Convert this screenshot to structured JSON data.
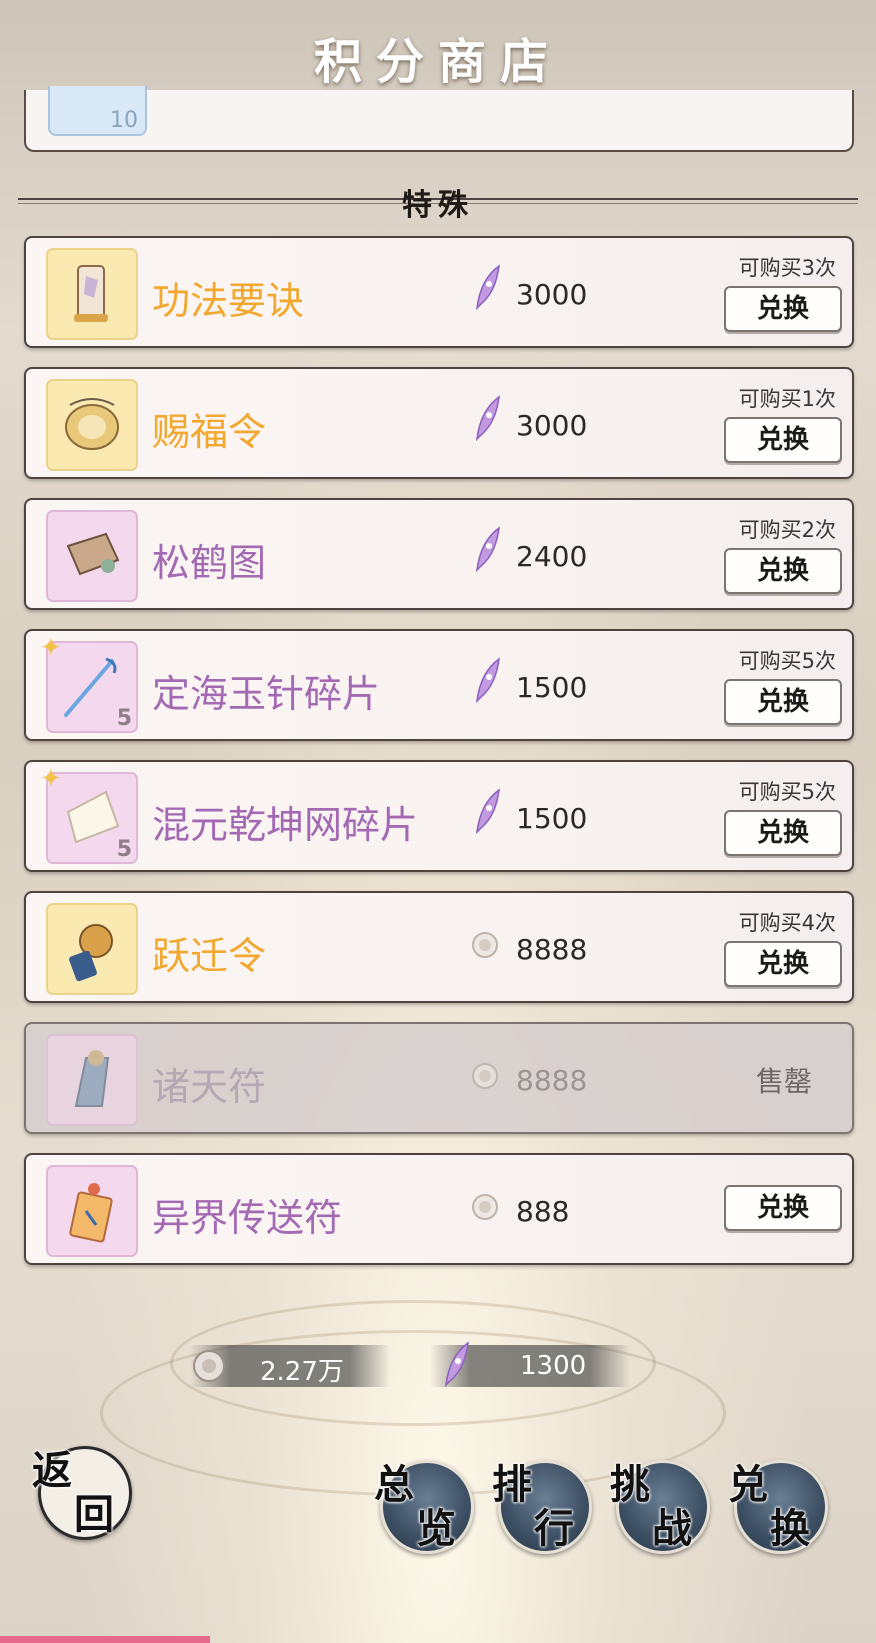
{
  "header": {
    "title": "积分商店"
  },
  "top_partial_item": {
    "quantity": "10"
  },
  "section": {
    "label": "特殊"
  },
  "items": [
    {
      "name": "功法要诀",
      "name_color": "gold",
      "icon": "scroll-bundle-icon",
      "currency": "purple-feather",
      "price": "3000",
      "limit": "可购买3次",
      "button": "兑换"
    },
    {
      "name": "赐福令",
      "name_color": "gold",
      "icon": "blessing-token-icon",
      "currency": "purple-feather",
      "price": "3000",
      "limit": "可购买1次",
      "button": "兑换"
    },
    {
      "name": "松鹤图",
      "name_color": "purple",
      "icon": "painting-scroll-icon",
      "currency": "purple-feather",
      "price": "2400",
      "limit": "可购买2次",
      "button": "兑换"
    },
    {
      "name": "定海玉针碎片",
      "name_color": "purple",
      "icon": "jade-needle-fragment-icon",
      "fragment_qty": "5",
      "currency": "purple-feather",
      "price": "1500",
      "limit": "可购买5次",
      "button": "兑换"
    },
    {
      "name": "混元乾坤网碎片",
      "name_color": "purple",
      "icon": "cosmic-net-fragment-icon",
      "fragment_qty": "5",
      "currency": "purple-feather",
      "price": "1500",
      "limit": "可购买5次",
      "button": "兑换"
    },
    {
      "name": "跃迁令",
      "name_color": "gold",
      "icon": "transition-token-icon",
      "currency": "silver-coin",
      "price": "8888",
      "limit": "可购买4次",
      "button": "兑换"
    },
    {
      "name": "诸天符",
      "name_color": "purple",
      "icon": "heaven-talisman-icon",
      "currency": "silver-coin",
      "price": "8888",
      "status": "售罄"
    },
    {
      "name": "异界传送符",
      "name_color": "purple",
      "icon": "teleport-talisman-icon",
      "currency": "silver-coin",
      "price": "888",
      "button": "兑换"
    }
  ],
  "currency_bar": {
    "coin_amount": "2.27万",
    "feather_amount": "1300"
  },
  "nav": {
    "back": [
      "返",
      "回"
    ],
    "overview": [
      "总",
      "览"
    ],
    "rank": [
      "排",
      "行"
    ],
    "challenge": [
      "挑",
      "战"
    ],
    "exchange": [
      "兑",
      "换"
    ]
  },
  "colors": {
    "gold_name": "#f2a72e",
    "purple_name": "#a36ab3",
    "progress": "#e56a8c"
  }
}
